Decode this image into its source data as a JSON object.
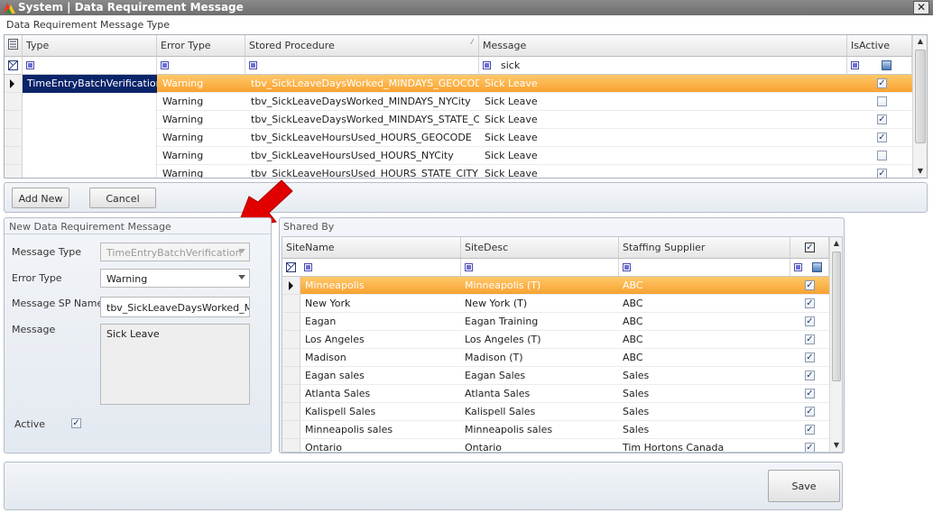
{
  "window": {
    "title": "System | Data Requirement Message",
    "close_glyph": "✕"
  },
  "top_section": {
    "label": "Data Requirement Message Type"
  },
  "top_grid": {
    "headers": {
      "type": "Type",
      "error_type": "Error Type",
      "stored_procedure": "Stored Procedure",
      "message": "Message",
      "is_active": "IsActive"
    },
    "filter": {
      "message": "sick"
    },
    "type_value": "TimeEntryBatchVerification",
    "rows": [
      {
        "error_type": "Warning",
        "sp": "tbv_SickLeaveDaysWorked_MINDAYS_GEOCODE",
        "message": "Sick Leave",
        "active": true
      },
      {
        "error_type": "Warning",
        "sp": "tbv_SickLeaveDaysWorked_MINDAYS_NYCity",
        "message": "Sick Leave",
        "active": false
      },
      {
        "error_type": "Warning",
        "sp": "tbv_SickLeaveDaysWorked_MINDAYS_STATE_CITY",
        "message": "Sick Leave",
        "active": true
      },
      {
        "error_type": "Warning",
        "sp": "tbv_SickLeaveHoursUsed_HOURS_GEOCODE",
        "message": "Sick Leave",
        "active": true
      },
      {
        "error_type": "Warning",
        "sp": "tbv_SickLeaveHoursUsed_HOURS_NYCity",
        "message": "Sick Leave",
        "active": false
      },
      {
        "error_type": "Warning",
        "sp": "tbv_SickLeaveHoursUsed_HOURS_STATE_CITY",
        "message": "Sick Leave",
        "active": true
      }
    ]
  },
  "buttons": {
    "add_new": "Add New",
    "cancel": "Cancel",
    "save": "Save"
  },
  "form": {
    "title": "New Data Requirement Message",
    "message_type_label": "Message Type",
    "message_type_value": "TimeEntryBatchVerification",
    "error_type_label": "Error Type",
    "error_type_value": "Warning",
    "sp_label": "Message SP Name",
    "sp_value": "tbv_SickLeaveDaysWorked_MI",
    "message_label": "Message",
    "message_value": "Sick Leave",
    "active_label": "Active",
    "active": true
  },
  "shared_by": {
    "title": "Shared By",
    "headers": {
      "site_name": "SiteName",
      "site_desc": "SiteDesc",
      "staffing_supplier": "Staffing Supplier"
    },
    "rows": [
      {
        "name": "Minneapolis",
        "desc": "Minneapolis (T)",
        "supplier": "ABC",
        "checked": true
      },
      {
        "name": "New York",
        "desc": "New York (T)",
        "supplier": "ABC",
        "checked": true
      },
      {
        "name": "Eagan",
        "desc": "Eagan Training",
        "supplier": "ABC",
        "checked": true
      },
      {
        "name": "Los Angeles",
        "desc": "Los Angeles (T)",
        "supplier": "ABC",
        "checked": true
      },
      {
        "name": "Madison",
        "desc": "Madison (T)",
        "supplier": "ABC",
        "checked": true
      },
      {
        "name": "Eagan sales",
        "desc": "Eagan Sales",
        "supplier": "Sales",
        "checked": true
      },
      {
        "name": "Atlanta Sales",
        "desc": "Atlanta Sales",
        "supplier": "Sales",
        "checked": true
      },
      {
        "name": "Kalispell Sales",
        "desc": "Kalispell Sales",
        "supplier": "Sales",
        "checked": true
      },
      {
        "name": "Minneapolis sales",
        "desc": "Minneapolis sales",
        "supplier": "Sales",
        "checked": true
      },
      {
        "name": "Ontario",
        "desc": "Ontario",
        "supplier": "Tim Hortons Canada",
        "checked": true
      }
    ]
  },
  "colors": {
    "selected_row": "#f8a230",
    "type_cell": "#0a246a",
    "annotation_arrow": "#e00000"
  }
}
